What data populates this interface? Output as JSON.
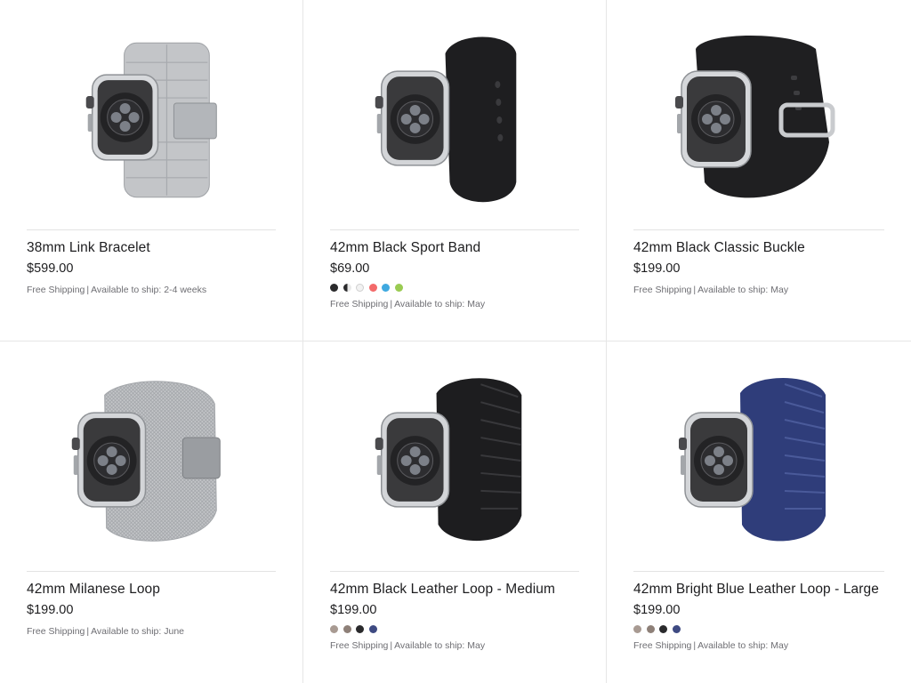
{
  "products": [
    {
      "name": "38mm Link Bracelet",
      "price": "$599.00",
      "shipping_label": "Free Shipping",
      "availability_label": "Available to ship:",
      "availability_value": "2-4 weeks",
      "band_color": "#c3c5c8",
      "swatches": []
    },
    {
      "name": "42mm Black Sport Band",
      "price": "$69.00",
      "shipping_label": "Free Shipping",
      "availability_label": "Available to ship:",
      "availability_value": "May",
      "band_color": "#1e1e20",
      "swatches": [
        "#2a2a2c",
        "half-black-white",
        "#f2f2f2",
        "#f36a6a",
        "#3fa9e0",
        "#9acb52"
      ]
    },
    {
      "name": "42mm Black Classic Buckle",
      "price": "$199.00",
      "shipping_label": "Free Shipping",
      "availability_label": "Available to ship:",
      "availability_value": "May",
      "band_color": "#1f1f21",
      "swatches": []
    },
    {
      "name": "42mm Milanese Loop",
      "price": "$199.00",
      "shipping_label": "Free Shipping",
      "availability_label": "Available to ship:",
      "availability_value": "June",
      "band_color": "#bfc1c4",
      "swatches": []
    },
    {
      "name": "42mm Black Leather Loop - Medium",
      "price": "$199.00",
      "shipping_label": "Free Shipping",
      "availability_label": "Available to ship:",
      "availability_value": "May",
      "band_color": "#1d1d1f",
      "swatches": [
        "#a89a92",
        "#8e8078",
        "#2a2a2c",
        "#3e4a82"
      ]
    },
    {
      "name": "42mm Bright Blue Leather Loop - Large",
      "price": "$199.00",
      "shipping_label": "Free Shipping",
      "availability_label": "Available to ship:",
      "availability_value": "May",
      "band_color": "#2f3d7a",
      "swatches": [
        "#a89a92",
        "#8e8078",
        "#2a2a2c",
        "#3e4a82"
      ]
    }
  ]
}
